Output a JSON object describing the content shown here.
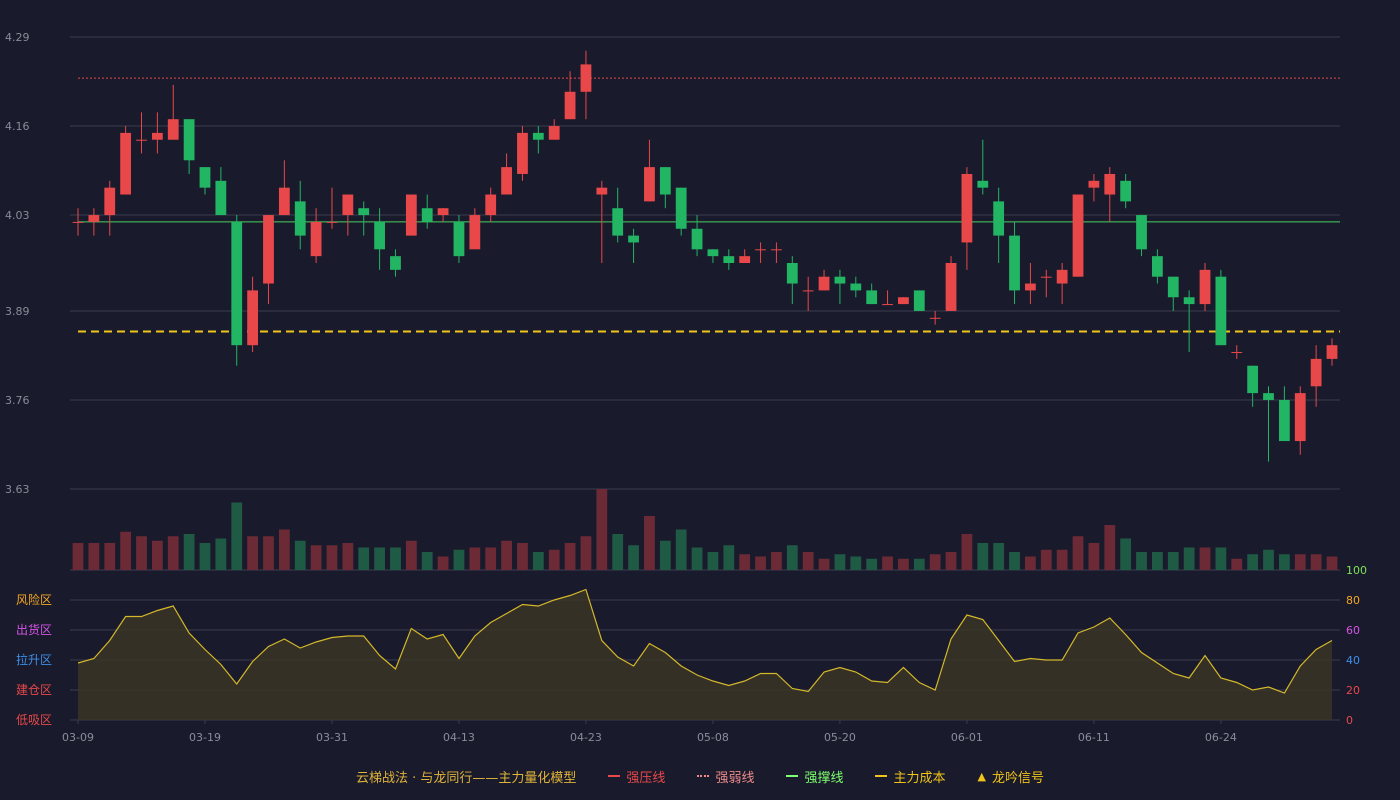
{
  "chart_data": {
    "type": "candlestick",
    "price_axis": {
      "ticks": [
        "4.29",
        "4.16",
        "4.03",
        "3.89",
        "3.76",
        "3.63"
      ],
      "range": [
        3.63,
        4.29
      ]
    },
    "x_ticks": [
      {
        "index": 0,
        "label": "03-09"
      },
      {
        "index": 8,
        "label": "03-19"
      },
      {
        "index": 16,
        "label": "03-31"
      },
      {
        "index": 24,
        "label": "04-13"
      },
      {
        "index": 32,
        "label": "04-23"
      },
      {
        "index": 40,
        "label": "05-08"
      },
      {
        "index": 48,
        "label": "05-20"
      },
      {
        "index": 56,
        "label": "06-01"
      },
      {
        "index": 64,
        "label": "06-11"
      },
      {
        "index": 72,
        "label": "06-24"
      }
    ],
    "candles": [
      [
        4.02,
        4.02,
        4.04,
        4.0
      ],
      [
        4.02,
        4.03,
        4.04,
        4.0
      ],
      [
        4.03,
        4.07,
        4.08,
        4.0
      ],
      [
        4.06,
        4.15,
        4.16,
        4.06
      ],
      [
        4.14,
        4.14,
        4.18,
        4.12
      ],
      [
        4.14,
        4.15,
        4.18,
        4.12
      ],
      [
        4.14,
        4.17,
        4.22,
        4.14
      ],
      [
        4.17,
        4.11,
        4.17,
        4.09
      ],
      [
        4.1,
        4.07,
        4.1,
        4.06
      ],
      [
        4.08,
        4.03,
        4.1,
        4.03
      ],
      [
        4.02,
        3.84,
        4.03,
        3.81
      ],
      [
        3.84,
        3.92,
        3.94,
        3.83
      ],
      [
        3.93,
        4.03,
        4.03,
        3.9
      ],
      [
        4.03,
        4.07,
        4.11,
        4.03
      ],
      [
        4.05,
        4.0,
        4.08,
        3.98
      ],
      [
        3.97,
        4.02,
        4.04,
        3.96
      ],
      [
        4.02,
        4.02,
        4.07,
        4.01
      ],
      [
        4.03,
        4.06,
        4.06,
        4.0
      ],
      [
        4.04,
        4.03,
        4.05,
        4.0
      ],
      [
        4.02,
        3.98,
        4.04,
        3.95
      ],
      [
        3.97,
        3.95,
        3.98,
        3.94
      ],
      [
        4.0,
        4.06,
        4.06,
        4.0
      ],
      [
        4.04,
        4.02,
        4.06,
        4.01
      ],
      [
        4.03,
        4.04,
        4.04,
        4.02
      ],
      [
        4.02,
        3.97,
        4.03,
        3.96
      ],
      [
        3.98,
        4.03,
        4.04,
        3.98
      ],
      [
        4.03,
        4.06,
        4.07,
        4.02
      ],
      [
        4.06,
        4.1,
        4.12,
        4.06
      ],
      [
        4.09,
        4.15,
        4.16,
        4.08
      ],
      [
        4.15,
        4.14,
        4.16,
        4.12
      ],
      [
        4.14,
        4.16,
        4.17,
        4.14
      ],
      [
        4.17,
        4.21,
        4.24,
        4.17
      ],
      [
        4.21,
        4.25,
        4.27,
        4.17
      ],
      [
        4.06,
        4.07,
        4.08,
        3.96
      ],
      [
        4.04,
        4.0,
        4.07,
        3.99
      ],
      [
        4.0,
        3.99,
        4.01,
        3.96
      ],
      [
        4.05,
        4.1,
        4.14,
        4.05
      ],
      [
        4.1,
        4.06,
        4.1,
        4.04
      ],
      [
        4.07,
        4.01,
        4.07,
        4.0
      ],
      [
        4.01,
        3.98,
        4.03,
        3.97
      ],
      [
        3.98,
        3.97,
        3.98,
        3.96
      ],
      [
        3.97,
        3.96,
        3.98,
        3.95
      ],
      [
        3.96,
        3.97,
        3.98,
        3.96
      ],
      [
        3.98,
        3.98,
        3.99,
        3.96
      ],
      [
        3.98,
        3.98,
        3.99,
        3.96
      ],
      [
        3.96,
        3.93,
        3.97,
        3.9
      ],
      [
        3.92,
        3.92,
        3.94,
        3.89
      ],
      [
        3.92,
        3.94,
        3.95,
        3.92
      ],
      [
        3.94,
        3.93,
        3.95,
        3.9
      ],
      [
        3.93,
        3.92,
        3.94,
        3.91
      ],
      [
        3.92,
        3.9,
        3.93,
        3.9
      ],
      [
        3.9,
        3.9,
        3.92,
        3.9
      ],
      [
        3.9,
        3.91,
        3.91,
        3.9
      ],
      [
        3.92,
        3.89,
        3.92,
        3.89
      ],
      [
        3.88,
        3.88,
        3.89,
        3.87
      ],
      [
        3.89,
        3.96,
        3.97,
        3.89
      ],
      [
        3.99,
        4.09,
        4.1,
        3.95
      ],
      [
        4.08,
        4.07,
        4.14,
        4.06
      ],
      [
        4.05,
        4.0,
        4.07,
        3.96
      ],
      [
        4.0,
        3.92,
        4.02,
        3.9
      ],
      [
        3.92,
        3.93,
        3.96,
        3.9
      ],
      [
        3.94,
        3.94,
        3.95,
        3.91
      ],
      [
        3.93,
        3.95,
        3.96,
        3.9
      ],
      [
        3.94,
        4.06,
        4.06,
        3.94
      ],
      [
        4.07,
        4.08,
        4.09,
        4.05
      ],
      [
        4.06,
        4.09,
        4.1,
        4.02
      ],
      [
        4.08,
        4.05,
        4.09,
        4.04
      ],
      [
        4.03,
        3.98,
        4.03,
        3.97
      ],
      [
        3.97,
        3.94,
        3.98,
        3.93
      ],
      [
        3.94,
        3.91,
        3.94,
        3.89
      ],
      [
        3.91,
        3.9,
        3.92,
        3.83
      ],
      [
        3.9,
        3.95,
        3.96,
        3.89
      ],
      [
        3.94,
        3.84,
        3.95,
        3.84
      ],
      [
        3.83,
        3.83,
        3.84,
        3.82
      ],
      [
        3.81,
        3.77,
        3.81,
        3.75
      ],
      [
        3.77,
        3.76,
        3.78,
        3.67
      ],
      [
        3.76,
        3.7,
        3.78,
        3.7
      ],
      [
        3.7,
        3.77,
        3.78,
        3.68
      ],
      [
        3.78,
        3.82,
        3.84,
        3.75
      ],
      [
        3.82,
        3.84,
        3.85,
        3.81
      ]
    ],
    "volume": [
      12,
      12,
      12,
      17,
      15,
      13,
      15,
      16,
      12,
      14,
      30,
      15,
      15,
      18,
      13,
      11,
      11,
      12,
      10,
      10,
      10,
      13,
      8,
      6,
      9,
      10,
      10,
      13,
      12,
      8,
      9,
      12,
      15,
      36,
      16,
      11,
      24,
      13,
      18,
      10,
      8,
      11,
      7,
      6,
      8,
      11,
      8,
      5,
      7,
      6,
      5,
      6,
      5,
      5,
      7,
      8,
      16,
      12,
      12,
      8,
      6,
      9,
      9,
      15,
      12,
      20,
      14,
      8,
      8,
      8,
      10,
      10,
      10,
      5,
      7,
      9,
      7,
      7,
      7,
      6
    ],
    "oscillator": {
      "axis_ticks": [
        {
          "value": 100,
          "label": "100",
          "color": "#7de35a"
        },
        {
          "value": 80,
          "label": "80",
          "color": "#f5a623"
        },
        {
          "value": 60,
          "label": "60",
          "color": "#d654e8"
        },
        {
          "value": 40,
          "label": "40",
          "color": "#3d8fe8"
        },
        {
          "value": 20,
          "label": "20",
          "color": "#e8484a"
        },
        {
          "value": 0,
          "label": "0",
          "color": "#e8484a"
        }
      ],
      "zones": [
        {
          "label": "风险区",
          "value": 80,
          "color": "#f5a623"
        },
        {
          "label": "出货区",
          "value": 60,
          "color": "#d654e8"
        },
        {
          "label": "拉升区",
          "value": 40,
          "color": "#3d8fe8"
        },
        {
          "label": "建仓区",
          "value": 20,
          "color": "#e8484a"
        },
        {
          "label": "低吸区",
          "value": 0,
          "color": "#e8484a"
        }
      ],
      "values": [
        38,
        41,
        53,
        69,
        69,
        73,
        76,
        58,
        47,
        37,
        24,
        39,
        49,
        54,
        48,
        52,
        55,
        56,
        56,
        43,
        34,
        61,
        54,
        57,
        41,
        56,
        65,
        71,
        77,
        76,
        80,
        83,
        87,
        53,
        42,
        36,
        51,
        45,
        36,
        30,
        26,
        23,
        26,
        31,
        31,
        21,
        19,
        32,
        35,
        32,
        26,
        25,
        35,
        25,
        20,
        54,
        70,
        67,
        53,
        39,
        41,
        40,
        40,
        58,
        62,
        68,
        57,
        45,
        38,
        31,
        28,
        43,
        28,
        25,
        20,
        22,
        18,
        36,
        47,
        53
      ]
    },
    "lines": [
      {
        "name": "强压线",
        "value": 4.23,
        "color": "#e8484a",
        "style": "dotted"
      },
      {
        "name": "强撑线",
        "value": 4.02,
        "color": "#4ad15f",
        "style": "solid"
      },
      {
        "name": "主力成本",
        "value": 3.86,
        "color": "#f0c419",
        "style": "dashed"
      }
    ]
  },
  "legend": {
    "title": "云梯战法 · 与龙同行——主力量化模型",
    "items": [
      {
        "label": "强压线",
        "color": "#e8484a",
        "style": "solid"
      },
      {
        "label": "强弱线",
        "color": "#ef8a8a",
        "style": "dotted"
      },
      {
        "label": "强撑线",
        "color": "#7dff6e",
        "style": "solid"
      },
      {
        "label": "主力成本",
        "color": "#f0c419",
        "style": "dashed"
      },
      {
        "label": "龙吟信号",
        "color": "#f0c419",
        "style": "triangle"
      }
    ]
  },
  "colors": {
    "up": "#e8484a",
    "down": "#22b564",
    "grid": "#3a3c4e",
    "axis_text": "#8a8c99",
    "oscillator_line": "#d4b82a",
    "volume_up": "#6b2a35",
    "volume_down": "#1f5a45"
  }
}
